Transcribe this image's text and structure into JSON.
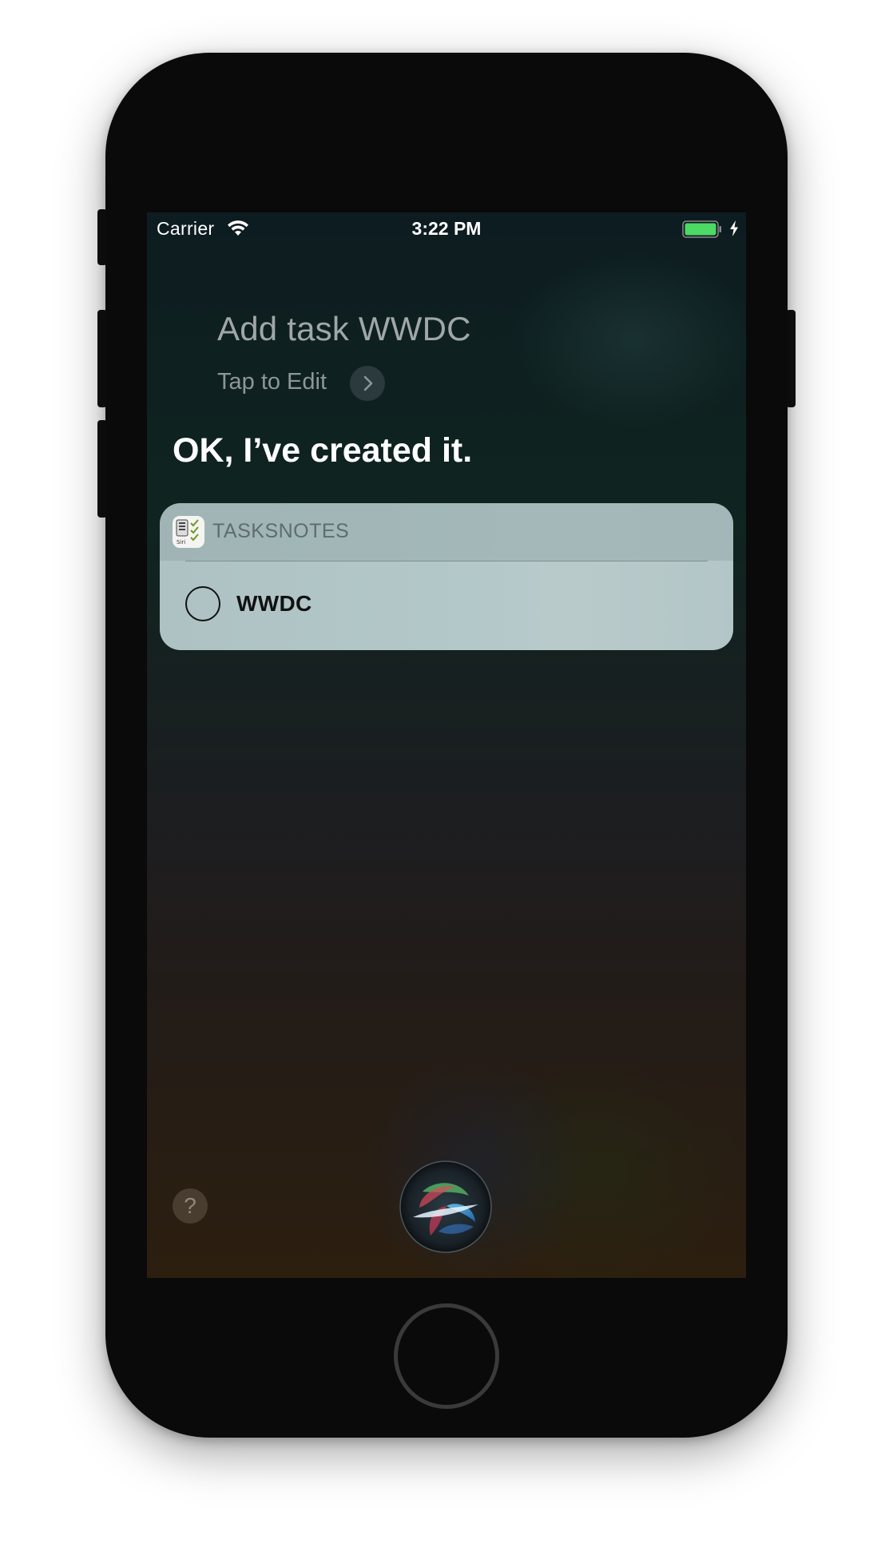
{
  "status_bar": {
    "carrier": "Carrier",
    "time": "3:22 PM",
    "wifi_icon": "wifi-icon",
    "battery_icon": "battery-full-icon",
    "battery_level": 1.0,
    "battery_color": "#4cd964",
    "charging_icon": "charging-bolt-icon"
  },
  "siri": {
    "query": "Add task WWDC",
    "tap_to_edit": "Tap to Edit",
    "chevron_icon": "chevron-right-icon",
    "response": "OK, I’ve created it.",
    "help_label": "?",
    "orb_icon": "siri-orb-icon"
  },
  "snippet": {
    "app_name": "TASKSNOTES",
    "app_icon": "tasksnotes-app-icon",
    "app_icon_text": "Siri",
    "task": {
      "title": "WWDC",
      "completed": false,
      "checkbox_icon": "circle-checkbox-icon"
    }
  },
  "device": {
    "home_button_icon": "home-button"
  }
}
